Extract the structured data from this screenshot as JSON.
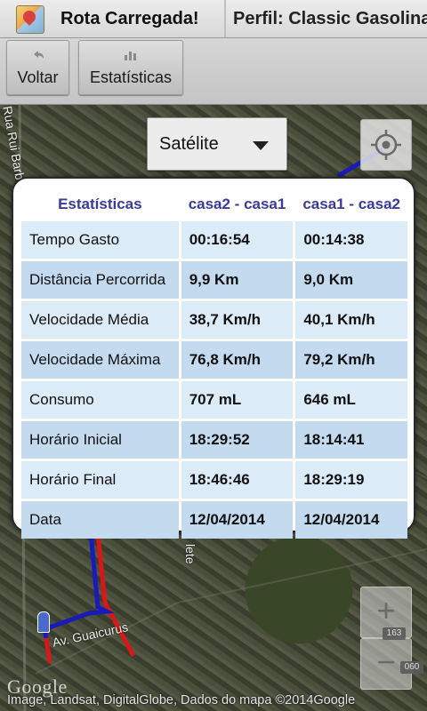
{
  "header": {
    "app_title": "Rota Carregada!",
    "profile": "Perfil: Classic Gasolina"
  },
  "toolbar": {
    "back_label": "Voltar",
    "stats_label": "Estatísticas"
  },
  "map": {
    "map_type": "Satélite",
    "street_labels": [
      "Rua Rui Barbo",
      "Av. Guaicurus",
      "lete",
      "Av."
    ],
    "road_badges": [
      "163",
      "060"
    ],
    "zoom_in": "+",
    "zoom_out": "−",
    "google_logo": "Google",
    "attribution": "Image, Landsat, DigitalGlobe, Dados do mapa ©2014Google",
    "route_colors": {
      "outbound": "#1a1ab8",
      "return": "#d81818"
    }
  },
  "stats": {
    "headers": [
      "Estatísticas",
      "casa2 - casa1",
      "casa1 - casa2"
    ],
    "rows": [
      {
        "label": "Tempo Gasto",
        "a": "00:16:54",
        "b": "00:14:38"
      },
      {
        "label": "Distância Percorrida",
        "a": "9,9 Km",
        "b": "9,0 Km"
      },
      {
        "label": "Velocidade Média",
        "a": "38,7 Km/h",
        "b": "40,1 Km/h"
      },
      {
        "label": "Velocidade Máxima",
        "a": "76,8 Km/h",
        "b": "79,2 Km/h"
      },
      {
        "label": "Consumo",
        "a": "707 mL",
        "b": "646 mL"
      },
      {
        "label": "Horário Inicial",
        "a": "18:29:52",
        "b": "18:14:41"
      },
      {
        "label": "Horário Final",
        "a": "18:46:46",
        "b": "18:29:19"
      },
      {
        "label": "Data",
        "a": "12/04/2014",
        "b": "12/04/2014"
      }
    ]
  }
}
